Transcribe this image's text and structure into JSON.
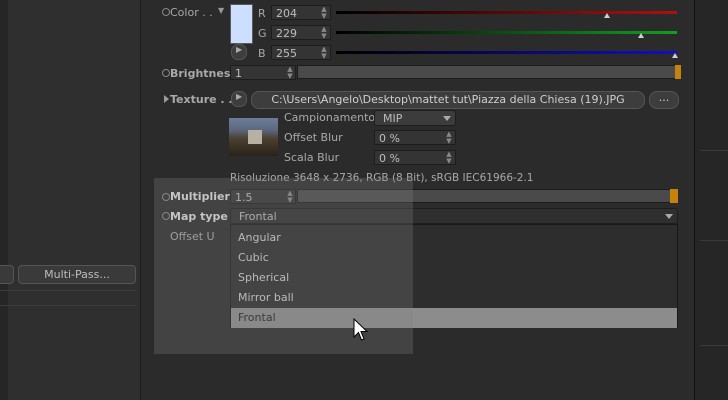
{
  "color": {
    "label": "Color . .",
    "r_label": "R",
    "r_value": "204",
    "g_label": "G",
    "g_value": "229",
    "b_label": "B",
    "b_value": "255",
    "swatch_hex": "#ccdfff"
  },
  "brightness": {
    "label": "Brightness",
    "value": "1",
    "level": 0.98
  },
  "texture": {
    "label": "Texture . .",
    "path": "C:\\Users\\Angelo\\Desktop\\mattet tut\\Piazza della Chiesa (19).JPG",
    "browse_label": "...",
    "sampling_label": "Campionamento",
    "sampling_value": "MIP",
    "offset_blur_label": "Offset Blur",
    "offset_blur_value": "0 %",
    "scale_blur_label": "Scala Blur",
    "scale_blur_value": "0 %",
    "resolution": "Risoluzione 3648 x 2736, RGB (8 Bit), sRGB IEC61966-2.1"
  },
  "multiplier": {
    "label": "Multiplier",
    "value": "1.5",
    "level": 0.99
  },
  "map_type": {
    "label": "Map type",
    "selected": "Frontal",
    "options": [
      "Angular",
      "Cubic",
      "Spherical",
      "Mirror ball",
      "Frontal"
    ],
    "highlighted_index": 4
  },
  "offset_u": {
    "label": "Offset U"
  },
  "left_panel": {
    "multipass_label": "Multi-Pass..."
  },
  "colors": {
    "accent_orange": "#c8820c",
    "red_track": "#b01010",
    "green_track": "#10a020",
    "blue_track": "#1010c0"
  }
}
